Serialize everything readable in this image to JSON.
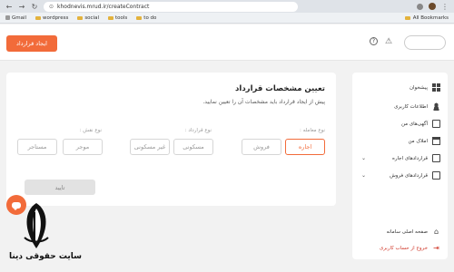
{
  "browser": {
    "url": "khodnevis.mrud.ir/createContract",
    "bookmarks": [
      "Gmail",
      "wordpress",
      "social",
      "tools",
      "to do"
    ],
    "all_bookmarks": "All Bookmarks"
  },
  "header": {
    "create_button": "ایجاد قرارداد"
  },
  "form": {
    "title": "تعیین مشخصات قرارداد",
    "subtitle": "پیش از ایجاد قرارداد باید مشخصات آن را تعیین نمایید.",
    "transaction_type_label": "نوع معامله :",
    "transaction_options": [
      "اجاره",
      "فروش"
    ],
    "contract_type_label": "نوع قرارداد :",
    "contract_options": [
      "مسکونی",
      "غیر مسکونی"
    ],
    "role_label": "نوع نقش :",
    "role_options": [
      "موجر",
      "مستاجر"
    ],
    "submit": "تایید"
  },
  "sidebar": {
    "items": [
      {
        "label": "پیشخوان",
        "icon": "grid-icon"
      },
      {
        "label": "اطلاعات کاربری",
        "icon": "user-icon"
      },
      {
        "label": "آگهی‌های من",
        "icon": "doc-icon"
      },
      {
        "label": "املاک من",
        "icon": "house-icon"
      },
      {
        "label": "قراردادهای اجاره",
        "icon": "doc-icon"
      },
      {
        "label": "قراردادهای فروش",
        "icon": "doc-icon"
      }
    ],
    "home_link": "صفحه اصلی سامانه",
    "logout": "خروج از حساب کاربری"
  },
  "watermark": {
    "text": "سایت حقوقی دینا"
  },
  "colors": {
    "accent": "#f26b3a",
    "logout": "#d0392b"
  }
}
